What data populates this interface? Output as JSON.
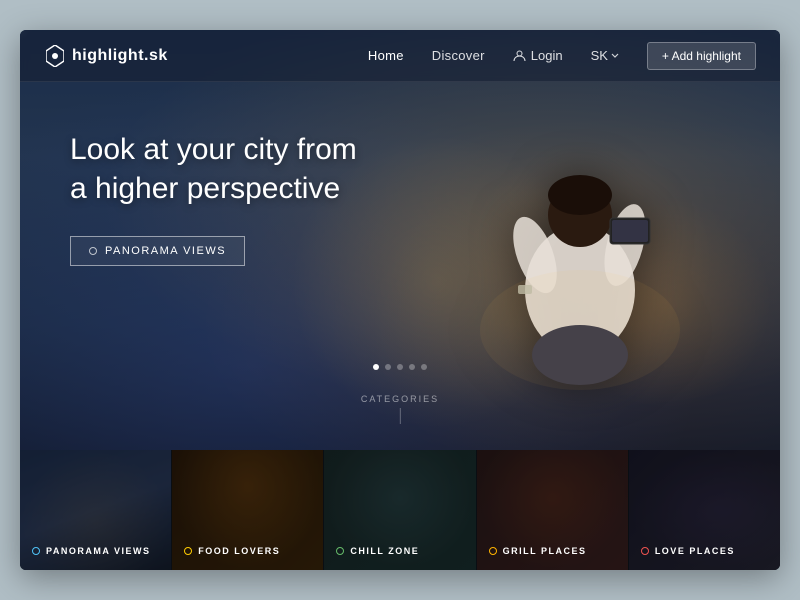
{
  "browser": {
    "background": "#b8cad4"
  },
  "navbar": {
    "logo": "highlight.sk",
    "links": [
      {
        "label": "Home",
        "active": true
      },
      {
        "label": "Discover",
        "active": false
      }
    ],
    "login_label": "Login",
    "lang_label": "SK",
    "add_button": "+ Add highlight"
  },
  "hero": {
    "title_line1": "Look at your city from",
    "title_line2": "a higher perspective",
    "cta_label": "PANORAMA VIEWS",
    "dots": [
      true,
      false,
      false,
      false,
      false
    ]
  },
  "categories_section": {
    "heading": "CATEGORIES",
    "items": [
      {
        "id": "panorama",
        "label": "PANORAMA VIEWS",
        "dot_color": "#4fc3f7"
      },
      {
        "id": "food",
        "label": "FOOD LOVERS",
        "dot_color": "#ffcc02"
      },
      {
        "id": "chill",
        "label": "CHILL ZONE",
        "dot_color": "#66bb6a"
      },
      {
        "id": "grill",
        "label": "GRILL PLACES",
        "dot_color": "#ffb300"
      },
      {
        "id": "love",
        "label": "LOVE PLACES",
        "dot_color": "#ef5350"
      }
    ]
  }
}
